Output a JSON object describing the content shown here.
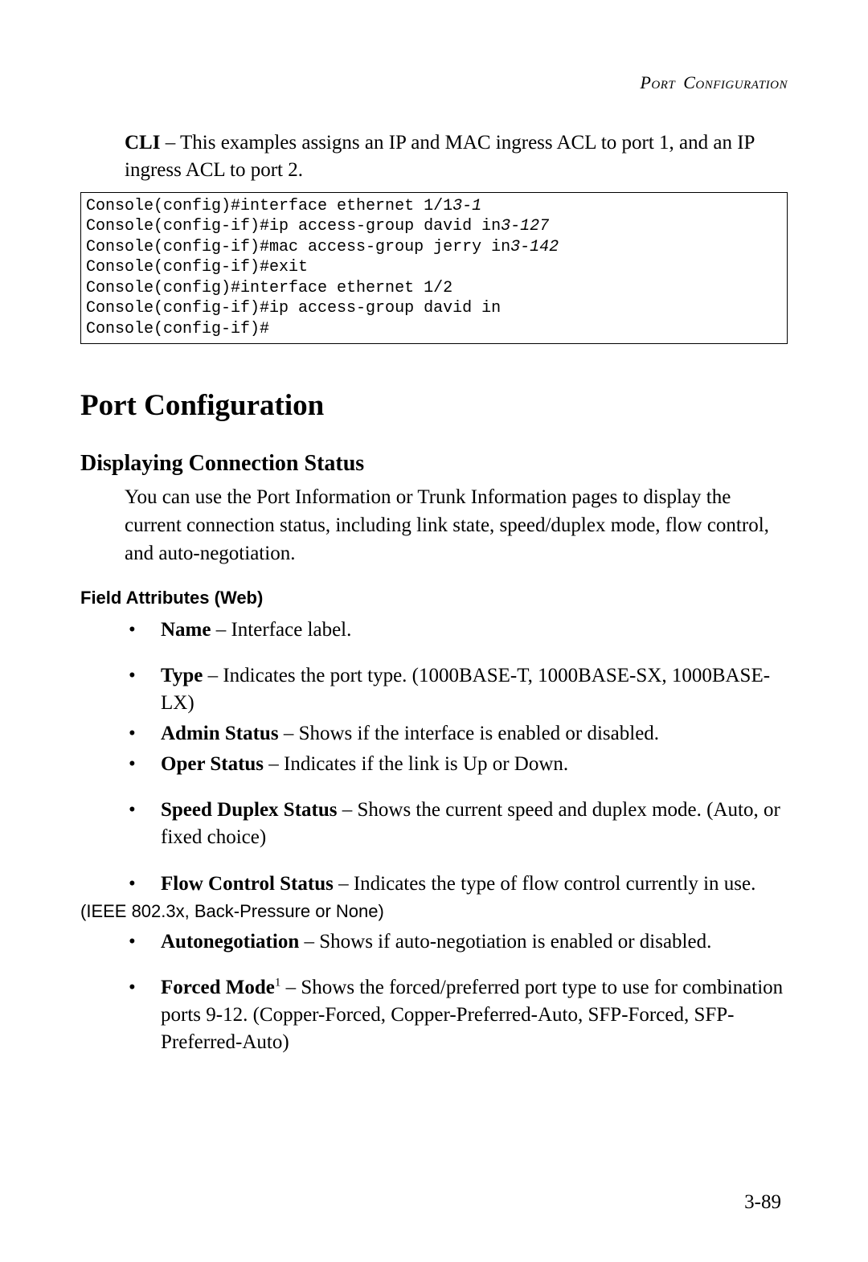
{
  "header": {
    "word1": "Port",
    "word2": "Configuration"
  },
  "intro": {
    "label": "CLI",
    "text": " – This examples assigns an IP and MAC ingress ACL to port 1, and an IP ingress ACL to port 2."
  },
  "code": {
    "l1a": "Console(config)#interface ethernet 1/1",
    "l1b": "3-1",
    "l2a": "Console(config-if)#ip access-group david in",
    "l2b": "3-127",
    "l3a": "Console(config-if)#mac access-group jerry in",
    "l3b": "3-142",
    "l4": "Console(config-if)#exit",
    "l5": "Console(config)#interface ethernet 1/2",
    "l6": "Console(config-if)#ip access-group david in",
    "l7": "Console(config-if)#"
  },
  "section_title": "Port Configuration",
  "subsection_title": "Displaying Connection Status",
  "body_para": "You can use the Port Information or Trunk Information pages to display the current connection status, including link state, speed/duplex mode, flow control, and auto-negotiation.",
  "field_attr_heading": "Field Attributes (Web)",
  "attrs": {
    "i0": {
      "term": "Name",
      "desc": " – Interface label."
    },
    "i1": {
      "term": "Type",
      "desc": " – Indicates the port type. (1000BASE-T, 1000BASE-SX, 1000BASE-LX)"
    },
    "i2": {
      "term": "Admin Status",
      "desc": " – Shows if the interface is enabled or disabled."
    },
    "i3": {
      "term": "Oper Status",
      "desc": " – Indicates if the link is Up or Down."
    },
    "i4": {
      "term": "Speed Duplex Status",
      "desc": " – Shows the current speed and duplex mode. (Auto, or fixed choice)"
    },
    "i5": {
      "term": "Flow Control Status",
      "desc": " – Indicates the type of flow control currently in use."
    },
    "i5_note": "(IEEE 802.3x, Back-Pressure or None)",
    "i6": {
      "term": "Autonegotiation",
      "desc": " – Shows if auto-negotiation is enabled or disabled."
    },
    "i7": {
      "term": "Forced Mode",
      "sup": "1",
      "desc": " – Shows the forced/preferred port type to use for combination ports 9-12. (Copper-Forced, Copper-Preferred-Auto, SFP-Forced, SFP-Preferred-Auto)"
    }
  },
  "page_number": "3-89"
}
